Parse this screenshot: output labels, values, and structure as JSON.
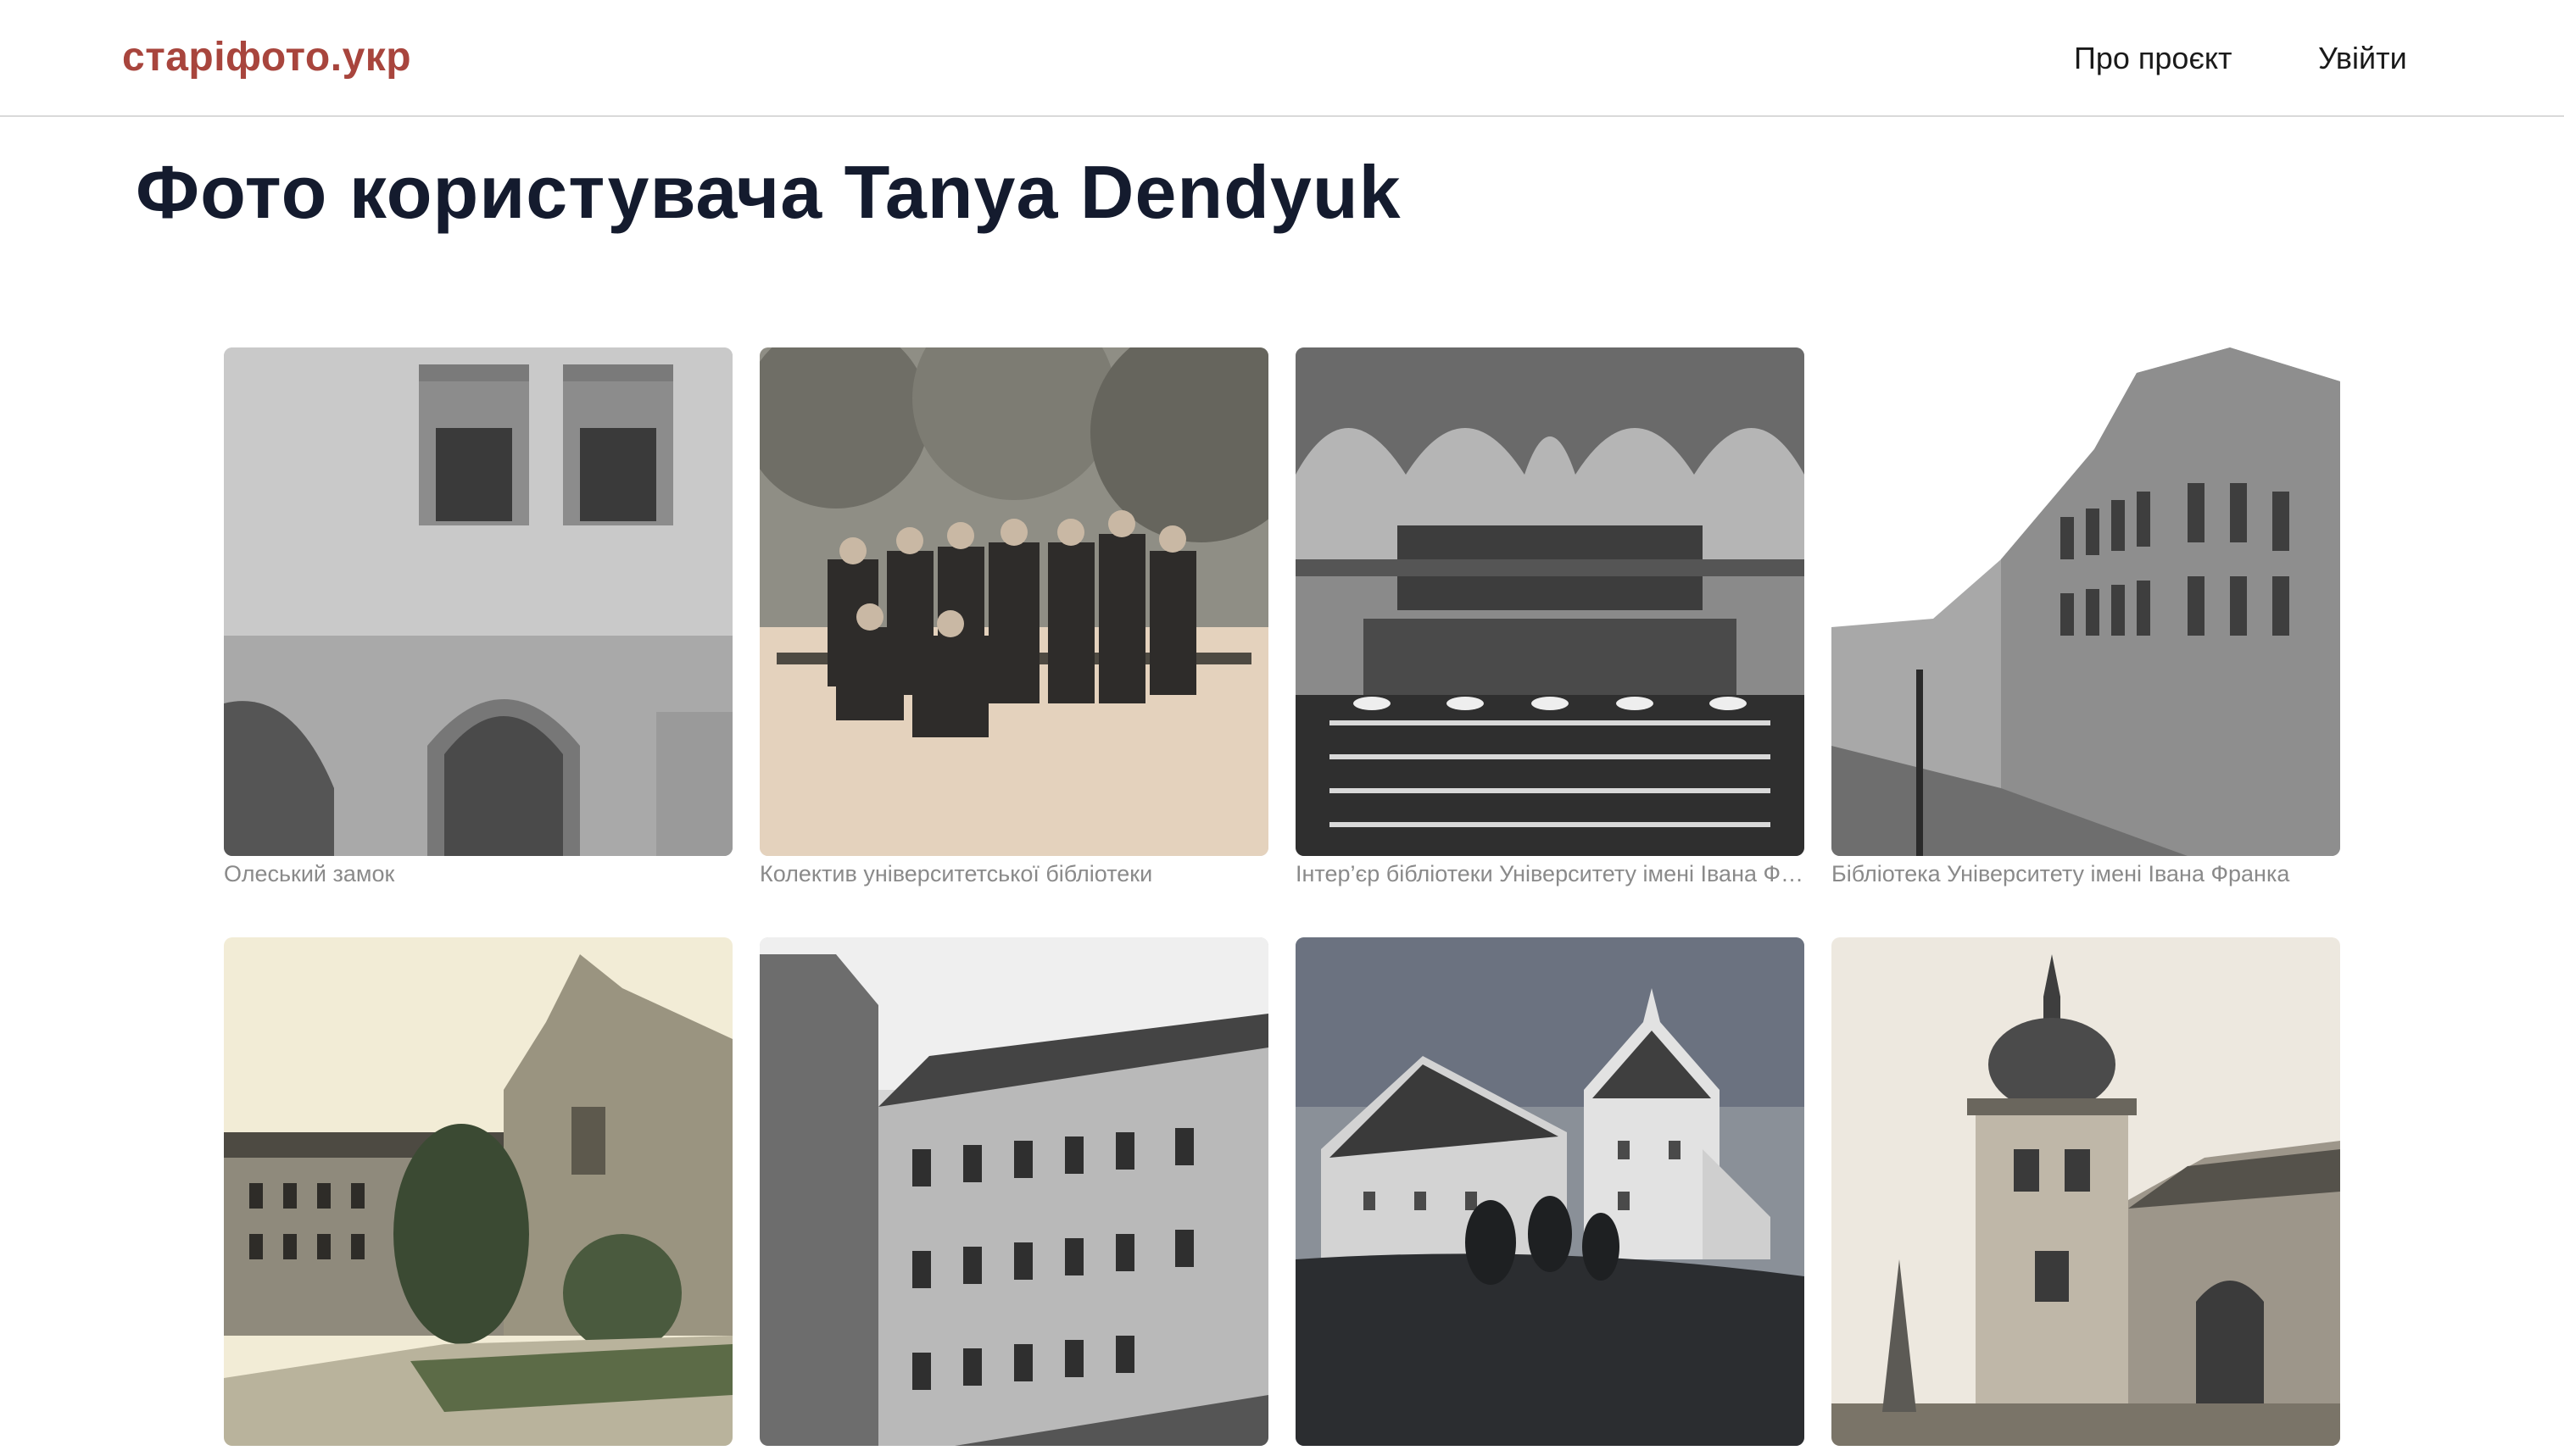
{
  "header": {
    "logo": "старіфото.укр",
    "nav": {
      "about": "Про проєкт",
      "login": "Увійти"
    }
  },
  "page": {
    "title": "Фото користувача Tanya Dendyuk"
  },
  "photos": [
    {
      "caption": "Олеський замок",
      "tone": "grayscale"
    },
    {
      "caption": "Колектив університетської бібліотеки",
      "tone": "sepia"
    },
    {
      "caption": "Інтер’єр бібліотеки Університету імені Івана Франка",
      "tone": "grayscale"
    },
    {
      "caption": "Бібліотека Університету імені Івана Франка",
      "tone": "grayscale"
    },
    {
      "caption": "",
      "tone": "postcard"
    },
    {
      "caption": "",
      "tone": "grayscale"
    },
    {
      "caption": "",
      "tone": "grayscale"
    },
    {
      "caption": "",
      "tone": "sepia-light"
    }
  ]
}
